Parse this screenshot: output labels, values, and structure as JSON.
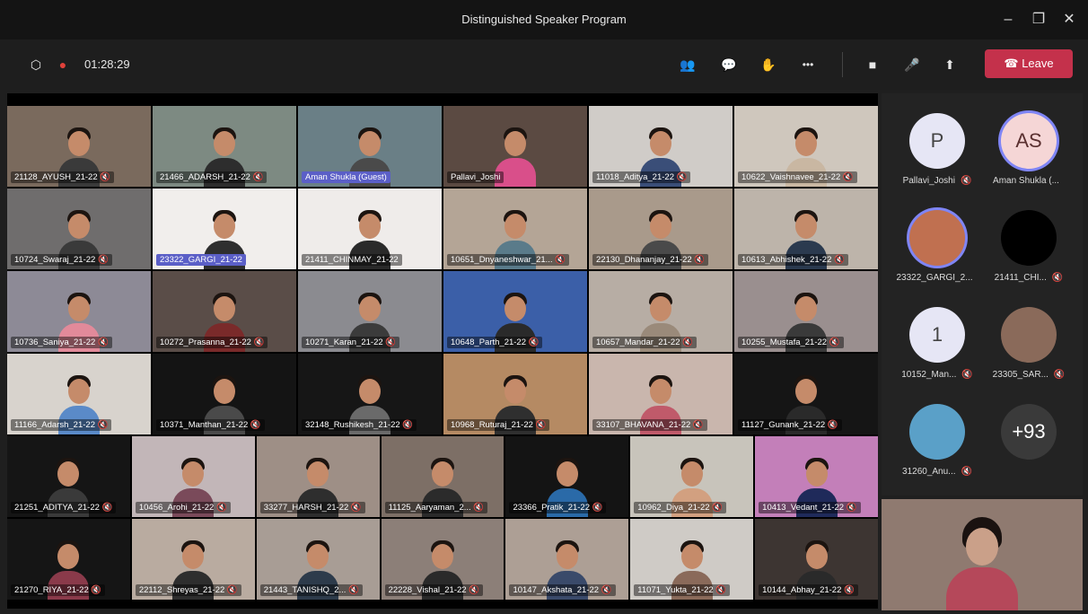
{
  "window": {
    "title": "Distinguished Speaker Program",
    "minimize": "–",
    "restore": "❐",
    "close": "✕"
  },
  "toolbar": {
    "timer": "01:28:29",
    "icons": {
      "shield": "⬡",
      "record": "●",
      "people": "👥",
      "chat": "💬",
      "reactions": "✋",
      "more": "•••",
      "camera": "■",
      "mic": "🎤",
      "share": "⬆"
    },
    "leave_label": "Leave",
    "leave_color": "#c4314b"
  },
  "grid": {
    "rows": [
      [
        {
          "name": "21128_AYUSH_21-22 🔇",
          "bg": "#7a6a5d",
          "shirt": "#3a3a3a"
        },
        {
          "name": "21466_ADARSH_21-22 🔇",
          "bg": "#7d8a82",
          "shirt": "#2d2d2d"
        },
        {
          "name": "Aman Shukla (Guest)",
          "bg": "#6a7f86",
          "shirt": "#4a4a4a",
          "hl": true
        },
        {
          "name": "Pallavi_Joshi",
          "bg": "#5b4a42",
          "shirt": "#d94f8a"
        },
        {
          "name": "11018_Aditya_21-22 🔇",
          "bg": "#d0ccc8",
          "shirt": "#3a4e78"
        },
        {
          "name": "10622_Vaishnavee_21-22 🔇",
          "bg": "#cfc7bd",
          "shirt": "#c9b7a2"
        }
      ],
      [
        {
          "name": "10724_Swaraj_21-22 🔇",
          "bg": "#6f6d6d",
          "shirt": "#3a3a3a"
        },
        {
          "name": "23322_GARGI_21-22",
          "bg": "#f1eeec",
          "shirt": "#2f2f2f",
          "hl": true
        },
        {
          "name": "21411_CHINMAY_21-22",
          "bg": "#efecea",
          "shirt": "#2a2a2a"
        },
        {
          "name": "10651_Dnyaneshwar_21... 🔇",
          "bg": "#b4a596",
          "shirt": "#5a7b8a"
        },
        {
          "name": "22130_Dhananjay_21-22 🔇",
          "bg": "#a99a8b",
          "shirt": "#4a4a4a"
        },
        {
          "name": "10613_Abhishek_21-22 🔇",
          "bg": "#bdb4aa",
          "shirt": "#2b3a4f"
        }
      ],
      [
        {
          "name": "10736_Saniya_21-22 🔇",
          "bg": "#8d8a96",
          "shirt": "#e28a9a"
        },
        {
          "name": "10272_Prasanna_21-22 🔇",
          "bg": "#5a4d48",
          "shirt": "#7a2a2a"
        },
        {
          "name": "10271_Karan_21-22 🔇",
          "bg": "#8b8b90",
          "shirt": "#3b3b3b"
        },
        {
          "name": "10648_Parth_21-22 🔇",
          "bg": "#3b5fa8",
          "shirt": "#2a2a2a"
        },
        {
          "name": "10657_Mandar_21-22 🔇",
          "bg": "#b7ada4",
          "shirt": "#9a8a7a"
        },
        {
          "name": "10255_Mustafa_21-22 🔇",
          "bg": "#9a8f8f",
          "shirt": "#3a3a3a"
        }
      ],
      [
        {
          "name": "11166_Adarsh_21-22 🔇",
          "bg": "#d8d3cd",
          "shirt": "#5a8ac8"
        },
        {
          "name": "10371_Manthan_21-22 🔇",
          "bg": "#141414",
          "shirt": "#4a4a4a"
        },
        {
          "name": "32148_Rushikesh_21-22 🔇",
          "bg": "#161616",
          "shirt": "#6a6a6a"
        },
        {
          "name": "10968_Ruturaj_21-22 🔇",
          "bg": "#b58a63",
          "shirt": "#2f2f2f"
        },
        {
          "name": "33107_BHAVANA_21-22 🔇",
          "bg": "#c9b6ad",
          "shirt": "#c05a6a"
        },
        {
          "name": "11127_Gunank_21-22 🔇",
          "bg": "#151515",
          "shirt": "#2a2a2a"
        }
      ],
      [
        {
          "name": "21251_ADITYA_21-22 🔇",
          "bg": "#151515",
          "shirt": "#3a3a3a"
        },
        {
          "name": "10456_Arohi_21-22 🔇",
          "bg": "#c2b6b8",
          "shirt": "#7a4a5a"
        },
        {
          "name": "33277_HARSH_21-22 🔇",
          "bg": "#9e8f86",
          "shirt": "#2e2e2e"
        },
        {
          "name": "11125_Aaryaman_2... 🔇",
          "bg": "#7d6f66",
          "shirt": "#2b2b2b"
        },
        {
          "name": "23366_Pratik_21-22 🔇",
          "bg": "#141414",
          "shirt": "#2a6aa8"
        },
        {
          "name": "10962_Diya_21-22 🔇",
          "bg": "#c8c4bb",
          "shirt": "#d2a080"
        },
        {
          "name": "10413_Vedant_21-22 🔇",
          "bg": "#c37fb9",
          "shirt": "#1f2a5a"
        }
      ],
      [
        {
          "name": "21270_RIYA_21-22 🔇",
          "bg": "#151515",
          "shirt": "#8a3a4a"
        },
        {
          "name": "22112_Shreyas_21-22 🔇",
          "bg": "#b9aba0",
          "shirt": "#2e2e2e"
        },
        {
          "name": "21443_TANISHQ_2... 🔇",
          "bg": "#a89d95",
          "shirt": "#2d3b4b"
        },
        {
          "name": "22228_Vishal_21-22 🔇",
          "bg": "#8c7f78",
          "shirt": "#2a2a2a"
        },
        {
          "name": "10147_Akshata_21-22 🔇",
          "bg": "#ad9f95",
          "shirt": "#3a4a6a"
        },
        {
          "name": "11071_Yukta_21-22 🔇",
          "bg": "#cfcbc6",
          "shirt": "#8a6a5a"
        },
        {
          "name": "10144_Abhay_21-22 🔇",
          "bg": "#3d3532",
          "shirt": "#2a2a2a"
        }
      ]
    ]
  },
  "sidebar": {
    "participants": [
      {
        "initials": "P",
        "name": "Pallavi_Joshi",
        "muted": "🔇",
        "avatar_bg": "#e6e6f5",
        "avatar_fg": "#444"
      },
      {
        "initials": "AS",
        "name": "Aman Shukla (...",
        "muted": "",
        "avatar_bg": "#f5d6d6",
        "avatar_fg": "#5a3030"
      },
      {
        "initials": "",
        "name": "23322_GARGI_2...",
        "muted": "",
        "avatar_bg": "#c07050",
        "avatar_fg": "#fff"
      },
      {
        "initials": "",
        "name": "21411_CHI...",
        "muted": "🔇",
        "avatar_bg": "#000000",
        "avatar_fg": "#fff"
      },
      {
        "initials": "1",
        "name": "10152_Man...",
        "muted": "🔇",
        "avatar_bg": "#e6e6f5",
        "avatar_fg": "#444"
      },
      {
        "initials": "",
        "name": "23305_SAR...",
        "muted": "🔇",
        "avatar_bg": "#8a6a5a",
        "avatar_fg": "#fff"
      },
      {
        "initials": "",
        "name": "31260_Anu...",
        "muted": "🔇",
        "avatar_bg": "#5aa0c8",
        "avatar_fg": "#fff"
      },
      {
        "initials": "+93",
        "name": "",
        "muted": "",
        "avatar_bg": "#3a3a3a",
        "avatar_fg": "#fff"
      }
    ]
  }
}
